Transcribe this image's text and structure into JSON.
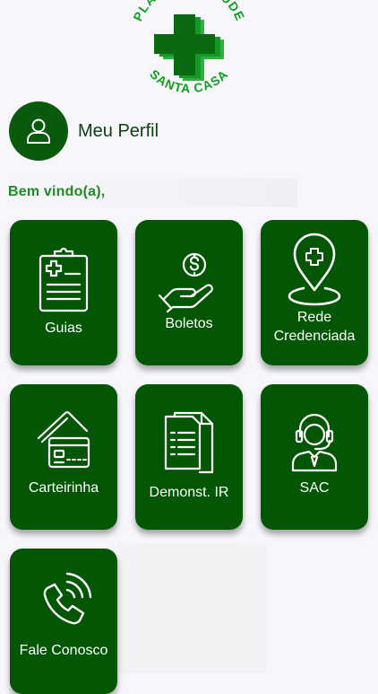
{
  "logo": {
    "top_text": "PLANO DE SAÚDE",
    "bottom_text": "SANTA CASA",
    "brand_color": "#11a020"
  },
  "profile": {
    "label": "Meu Perfil",
    "icon": "user-icon"
  },
  "welcome": {
    "text": "Bem vindo(a),"
  },
  "colors": {
    "tile_bg": "#035603",
    "accent": "#1e8a22"
  },
  "menu": [
    {
      "label": "Guias",
      "icon": "clipboard-medical-icon"
    },
    {
      "label": "Boletos",
      "icon": "hand-coin-icon"
    },
    {
      "label_line1": "Rede",
      "label_line2": "Credenciada",
      "icon": "location-pin-medical-icon"
    },
    {
      "label": "Carteirinha",
      "icon": "cards-icon"
    },
    {
      "label": "Demonst. IR",
      "icon": "documents-icon"
    },
    {
      "label": "SAC",
      "icon": "headset-agent-icon"
    },
    {
      "label": "Fale Conosco",
      "icon": "phone-icon"
    }
  ]
}
